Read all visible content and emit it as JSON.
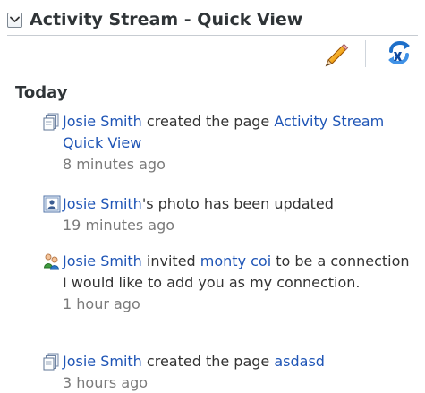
{
  "header": {
    "title": "Activity Stream - Quick View",
    "collapse_icon": "chevron-down-icon"
  },
  "toolbar": {
    "edit_icon": "pencil-icon",
    "refresh_icon": "refresh-icon"
  },
  "section": {
    "title": "Today"
  },
  "activities": [
    {
      "icon": "page-stack-icon",
      "actor": "Josie Smith",
      "action": " created the page ",
      "target": "Activity Stream Quick View",
      "time": "8 minutes ago"
    },
    {
      "icon": "profile-card-icon",
      "actor": "Josie Smith",
      "action": "'s photo has been updated",
      "time": "19 minutes ago"
    },
    {
      "icon": "connection-people-icon",
      "actor": "Josie Smith",
      "action": " invited ",
      "target": "monty coi",
      "action_suffix": " to be a connection",
      "note": "I would like to add you as my connection.",
      "time": "1 hour ago"
    },
    {
      "icon": "page-stack-icon",
      "actor": "Josie Smith",
      "action": " created the page ",
      "target": "asdasd",
      "time": "3 hours ago"
    }
  ],
  "colors": {
    "link": "#1f55b6",
    "text": "#333333",
    "time": "#7a7a7a",
    "header_border": "#c7ccd2"
  }
}
